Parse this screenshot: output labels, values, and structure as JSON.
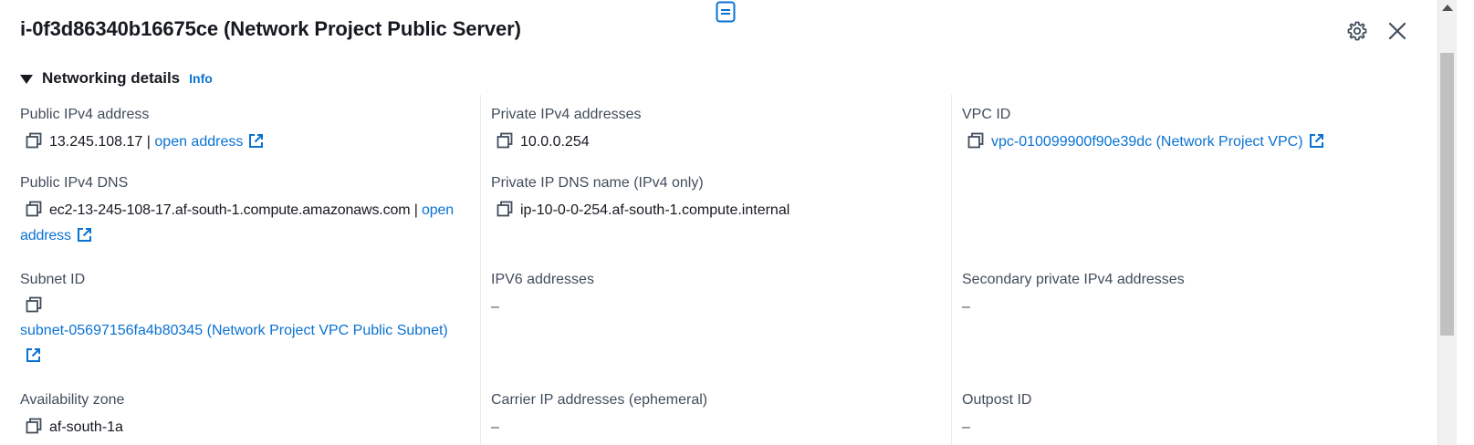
{
  "panel": {
    "title": "i-0f3d86340b16675ce (Network Project Public Server)"
  },
  "icons": {
    "drag_handle": "drag-handle-icon",
    "settings": "gear-icon",
    "close": "close-icon",
    "copy": "copy-icon",
    "external": "external-link-icon",
    "caret": "caret-down-icon"
  },
  "section": {
    "title": "Networking details",
    "info_label": "Info"
  },
  "fields": {
    "public_ipv4": {
      "label": "Public IPv4 address",
      "value": "13.245.108.17",
      "separator": "|",
      "link": "open address"
    },
    "private_ipv4": {
      "label": "Private IPv4 addresses",
      "value": "10.0.0.254"
    },
    "vpc_id": {
      "label": "VPC ID",
      "link": "vpc-010099900f90e39dc (Network Project VPC)"
    },
    "public_dns": {
      "label": "Public IPv4 DNS",
      "value": "ec2-13-245-108-17.af-south-1.compute.amazonaws.com",
      "separator": "|",
      "link": "open address"
    },
    "private_dns": {
      "label": "Private IP DNS name (IPv4 only)",
      "value": "ip-10-0-0-254.af-south-1.compute.internal"
    },
    "subnet_id": {
      "label": "Subnet ID",
      "link": "subnet-05697156fa4b80345 (Network Project VPC Public Subnet)"
    },
    "ipv6": {
      "label": "IPV6 addresses",
      "value": "–"
    },
    "secondary_private_ipv4": {
      "label": "Secondary private IPv4 addresses",
      "value": "–"
    },
    "availability_zone": {
      "label": "Availability zone",
      "value": "af-south-1a"
    },
    "carrier_ip": {
      "label": "Carrier IP addresses (ephemeral)",
      "value": "–"
    },
    "outpost_id": {
      "label": "Outpost ID",
      "value": "–"
    }
  },
  "colors": {
    "link": "#0972d3",
    "text": "#16191f",
    "label": "#414d5c",
    "divider": "#e9ebed"
  }
}
